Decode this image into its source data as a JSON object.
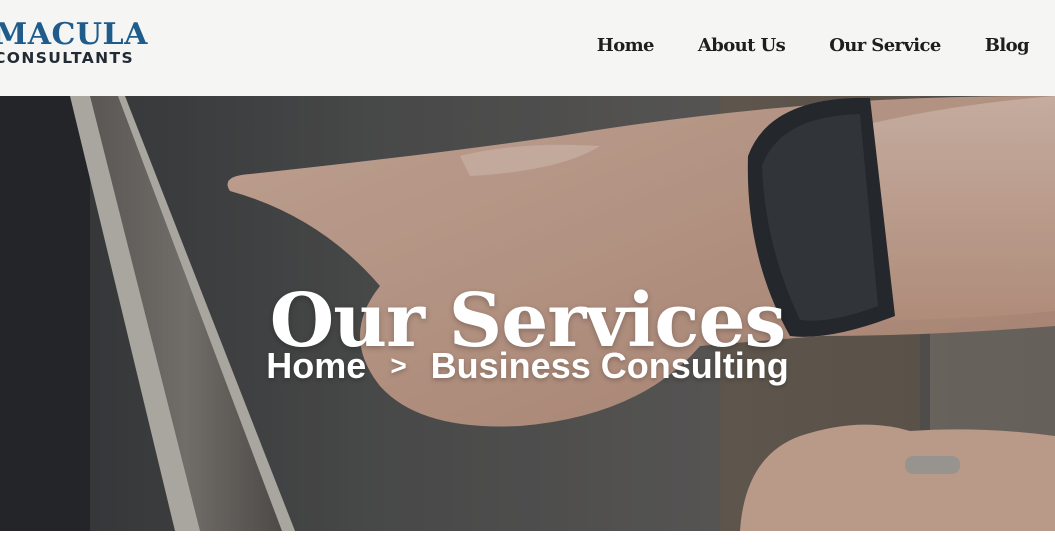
{
  "brand": {
    "name_top": "MACULA",
    "name_bottom": "CONSULTANTS"
  },
  "nav": {
    "items": [
      "Home",
      "About Us",
      "Our Service",
      "Blog"
    ]
  },
  "hero": {
    "title": "Our Services",
    "breadcrumb": {
      "home": "Home",
      "separator": ">",
      "current": "Business Consulting"
    }
  }
}
